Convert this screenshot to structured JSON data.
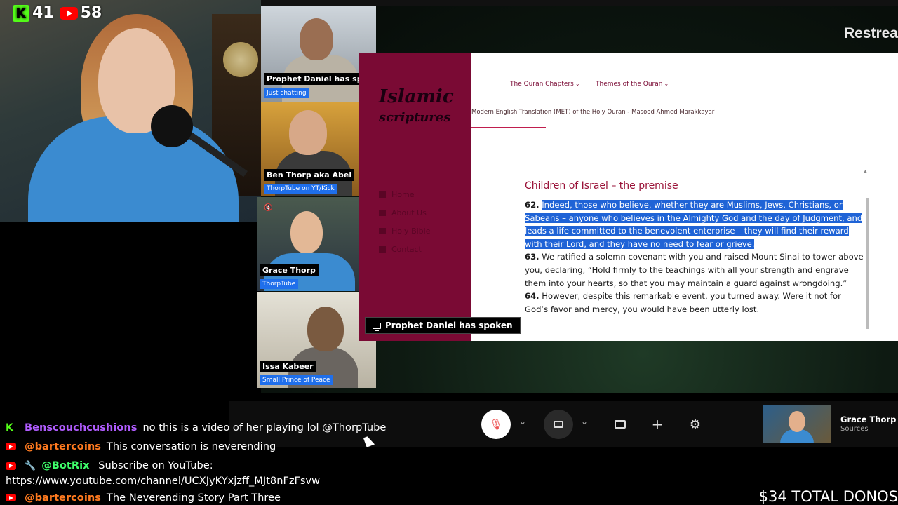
{
  "counters": {
    "kick_viewers": "41",
    "youtube_viewers": "58"
  },
  "call": {
    "branding": "Restrea",
    "participants": [
      {
        "name": "Prophet Daniel has spok",
        "subtitle": "Just chatting"
      },
      {
        "name": "Ben Thorp aka Abel",
        "subtitle": "ThorpTube on YT/Kick"
      },
      {
        "name": "Grace Thorp",
        "subtitle": "ThorpTube"
      },
      {
        "name": "Issa Kabeer",
        "subtitle": "Small Prince of Peace"
      }
    ],
    "screenshare_label": "Prophet Daniel has spoken"
  },
  "website": {
    "logo_line1": "Islamic",
    "logo_line2": "scriptures",
    "nav": [
      "Home",
      "About Us",
      "Holy Bible",
      "Contact"
    ],
    "menu": [
      "The Quran Chapters",
      "Themes of the Quran"
    ],
    "subtitle": "Modern English Translation (MET) of the Holy Quran - Masood Ahmed Marakkayar",
    "section_title": "Children of Israel – the premise",
    "verses": {
      "v62_num": "62.",
      "v62_text": "Indeed, those who believe, whether they are Muslims, Jews, Christians, or Sabeans – anyone who believes in the Almighty God and the day of Judgment, and leads a life committed to the benevolent enterprise – they will find their reward with their Lord, and they have no need to fear or grieve.",
      "v63_num": "63.",
      "v63_text": "We ratified a solemn covenant with you and raised Mount Sinai to tower above you, declaring, “Hold firmly to the teachings with all your strength and engrave them into your hearts, so that you may maintain a guard against wrongdoing.”",
      "v64_num": "64.",
      "v64_text": "However, despite this remarkable event, you turned away. Were it not for God’s favor and mercy, you would have been utterly lost."
    }
  },
  "controls": {
    "self_name": "Grace Thorp",
    "self_sub": "Sources"
  },
  "chat": [
    {
      "platform": "kick",
      "user": "Benscouchcushions",
      "text": "no this is a video of her playing lol @ThorpTube"
    },
    {
      "platform": "youtube",
      "user": "@bartercoins",
      "text": "This conversation is neverending"
    },
    {
      "platform": "youtube",
      "user": "@BotRix",
      "text": "Subscribe on YouTube: https://www.youtube.com/channel/UCXJyKYxjzff_MJt8nFzFsvw"
    },
    {
      "platform": "youtube",
      "user": "@bartercoins",
      "text": "The Neverending Story Part Three"
    }
  ],
  "donos": "$34 TOTAL DONOS"
}
